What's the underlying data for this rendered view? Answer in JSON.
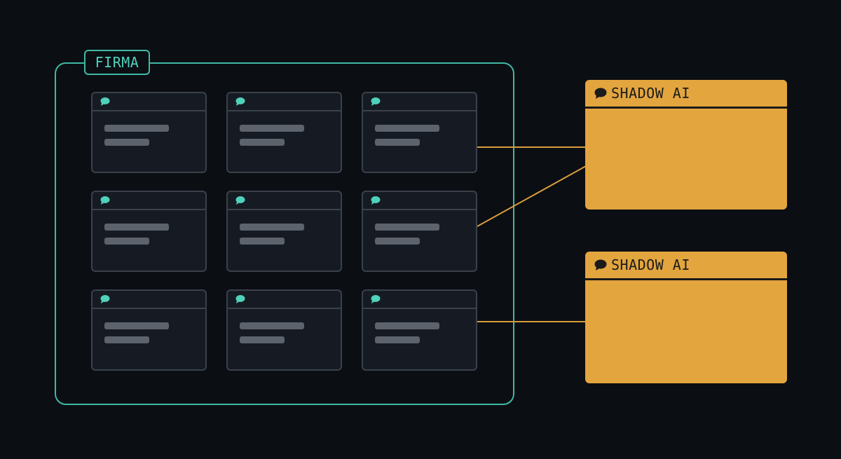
{
  "company": {
    "label": "FIRMA"
  },
  "shadow_ai": [
    {
      "title": "SHADOW AI"
    },
    {
      "title": "SHADOW AI"
    }
  ],
  "icons": {
    "window": "chat-bubble-icon",
    "shadow": "chat-bubble-icon"
  },
  "colors": {
    "background": "#0b0e13",
    "company_border": "#3fb9a5",
    "window_fill": "#161b23",
    "window_border": "#3a414b",
    "chat_icon": "#4fd1bb",
    "text_line": "#5d636c",
    "shadow_fill": "#e3a53e",
    "connector": "#d99c3e"
  }
}
